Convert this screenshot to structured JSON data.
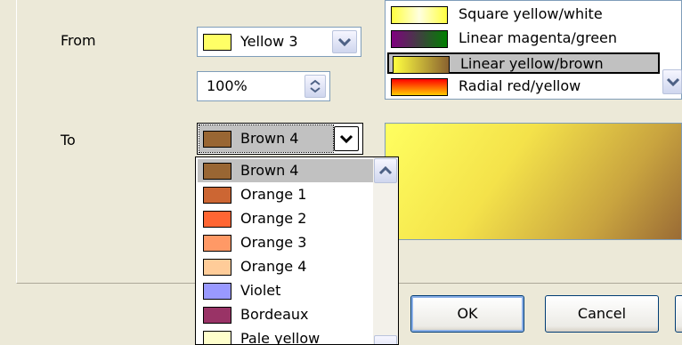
{
  "from": {
    "label": "From",
    "color_name": "Yellow 3",
    "color_hex": "#ffff66",
    "intensity": "100%"
  },
  "to": {
    "label": "To",
    "color_name": "Brown 4",
    "color_hex": "#996633"
  },
  "gradients": {
    "items": [
      {
        "label": "Square yellow/white",
        "css": "linear-gradient(90deg,#ffff40,#ffffe0,#ffff40)"
      },
      {
        "label": "Linear magenta/green",
        "css": "linear-gradient(90deg,#800080,#008000)"
      },
      {
        "label": "Linear yellow/brown",
        "css": "linear-gradient(90deg,#ffff40,#8a6230)"
      },
      {
        "label": "Radial red/yellow",
        "css": "linear-gradient(#ff0000,#ffcc00)"
      }
    ],
    "selected_index": 2
  },
  "color_list": {
    "items": [
      {
        "label": "Brown 4",
        "hex": "#996633"
      },
      {
        "label": "Orange 1",
        "hex": "#cc6633"
      },
      {
        "label": "Orange 2",
        "hex": "#ff6633"
      },
      {
        "label": "Orange 3",
        "hex": "#ff9966"
      },
      {
        "label": "Orange 4",
        "hex": "#ffcc99"
      },
      {
        "label": "Violet",
        "hex": "#9999ff"
      },
      {
        "label": "Bordeaux",
        "hex": "#993366"
      },
      {
        "label": "Pale yellow",
        "hex": "#ffffcc"
      }
    ],
    "selected_index": 0
  },
  "buttons": {
    "ok": "OK",
    "cancel": "Cancel"
  }
}
